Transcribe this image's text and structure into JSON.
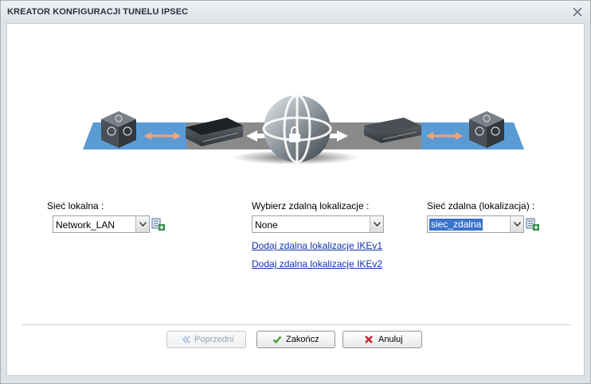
{
  "dialog": {
    "title": "KREATOR KONFIGURACJI TUNELU IPSEC"
  },
  "local_network": {
    "label": "Sieć lokalna :",
    "value": "Network_LAN"
  },
  "remote_location": {
    "label": "Wybierz zdalną lokalizacje :",
    "value": "None",
    "link_ikev1": "Dodaj zdalna lokalizacje IKEv1",
    "link_ikev2": "Dodaj zdalna lokalizacje IKEv2"
  },
  "remote_network": {
    "label": "Sieć zdalna (lokalizacja) :",
    "value": "siec_zdalna"
  },
  "buttons": {
    "previous": "Poprzedni",
    "finish": "Zakończ",
    "cancel": "Anuluj"
  },
  "colors": {
    "accent_blue": "#3a73c9",
    "link": "#1133aa",
    "check_green": "#3aa021",
    "cancel_red": "#c8202a"
  },
  "icons": {
    "close": "close-icon",
    "previous": "double-chevron-left-icon",
    "finish": "check-icon",
    "cancel": "x-icon",
    "add": "add-network-icon",
    "dropdown": "chevron-down-icon"
  }
}
